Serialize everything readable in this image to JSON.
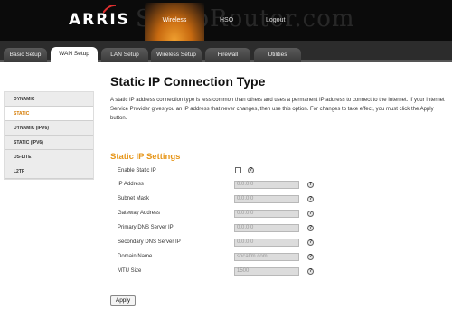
{
  "brand": {
    "logo": "ARRIS",
    "watermark": "SetupRouter.com"
  },
  "top_nav": [
    {
      "label": "Wireless",
      "active": true
    },
    {
      "label": "HSO"
    },
    {
      "label": "Logout"
    }
  ],
  "sub_nav": [
    {
      "label": "Basic Setup"
    },
    {
      "label": "WAN Setup",
      "active": true
    },
    {
      "label": "LAN Setup"
    },
    {
      "label": "Wireless Setup"
    },
    {
      "label": "Firewall"
    },
    {
      "label": "Utilities"
    }
  ],
  "sidebar": [
    {
      "label": "DYNAMIC"
    },
    {
      "label": "STATIC",
      "active": true
    },
    {
      "label": "DYNAMIC (IPV6)"
    },
    {
      "label": "STATIC (IPV6)"
    },
    {
      "label": "DS-LITE"
    },
    {
      "label": "L2TP"
    }
  ],
  "page": {
    "title": "Static IP Connection Type",
    "description": "A static IP address connection type is less common than others and uses a permanent IP address to connect to the Internet. If your Internet Service Provider gives you an IP address that never changes, then use this option. For changes to take effect, you must click the Apply button."
  },
  "settings": {
    "title": "Static IP Settings",
    "enable_label": "Enable Static IP",
    "help_symbol": "?",
    "fields": [
      {
        "label": "IP Address",
        "value": "0.0.0.0"
      },
      {
        "label": "Subnet Mask",
        "value": "0.0.0.0"
      },
      {
        "label": "Gateway Address",
        "value": "0.0.0.0"
      },
      {
        "label": "Primary DNS Server IP",
        "value": "0.0.0.0"
      },
      {
        "label": "Secondary DNS Server IP",
        "value": "0.0.0.0"
      },
      {
        "label": "Domain Name",
        "value": "socalfm.com"
      },
      {
        "label": "MTU Size",
        "value": "1500"
      }
    ]
  },
  "apply_label": "Apply",
  "colors": {
    "accent": "#e6961a",
    "active_tab": "#c86a10",
    "topbar": "#0b0b0b"
  }
}
